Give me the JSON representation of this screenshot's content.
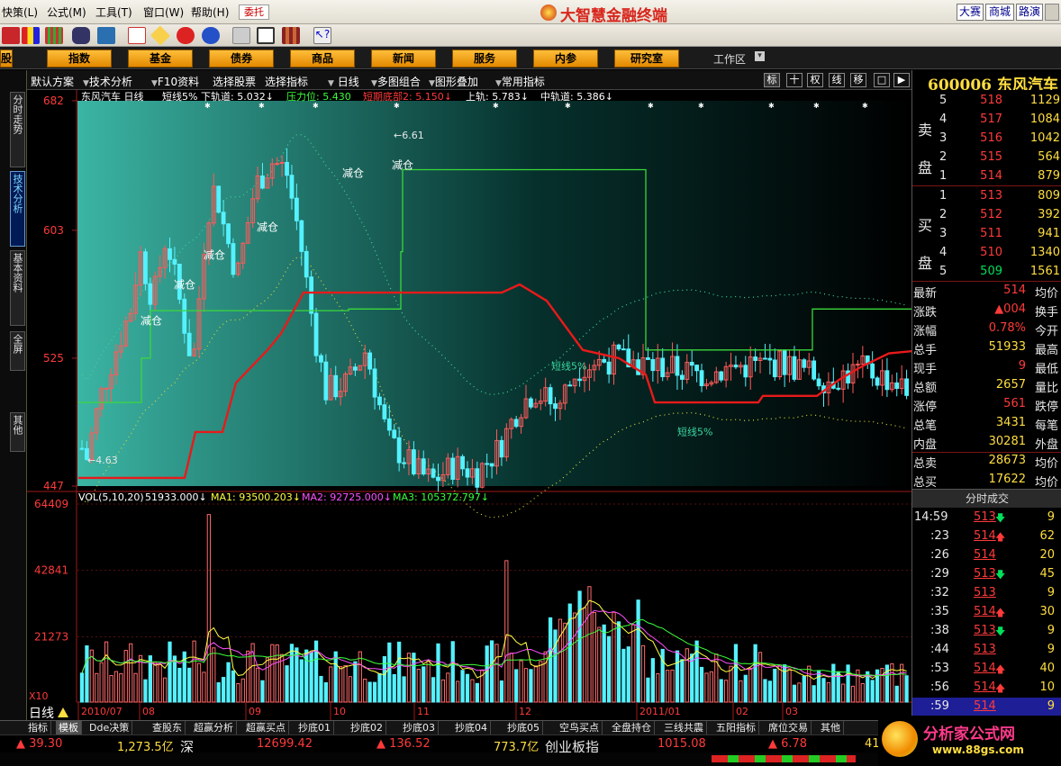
{
  "menu": {
    "items": [
      "快策(L)",
      "公式(M)",
      "工具(T)",
      "窗口(W)",
      "帮助(H)"
    ],
    "entrust": "委托",
    "logo": "大智慧金融终端",
    "right": [
      "大赛",
      "商城",
      "路演"
    ]
  },
  "nav": {
    "items": [
      "股",
      "指数",
      "基金",
      "债券",
      "商品",
      "新闻",
      "服务",
      "内参",
      "研究室"
    ],
    "workarea": "工作区"
  },
  "sidebar": {
    "tabs": [
      "分时走势",
      "技术分析",
      "基本资料",
      "全屏",
      "其他"
    ]
  },
  "toolbar2": {
    "items": [
      "默认方案",
      "技术分析",
      "F10资料",
      "选择股票",
      "选择指标",
      "日线",
      "多图组合",
      "图形叠加",
      "常用指标"
    ],
    "icons": [
      "标",
      "十",
      "权",
      "线",
      "移",
      "□",
      "▶"
    ]
  },
  "stock": {
    "code": "600006",
    "name": "东风汽车"
  },
  "chart_data": [
    {
      "type": "candlestick",
      "title": "东风汽车 日线",
      "indicator_header": {
        "name": "短线5%",
        "lower": "下轨道: 5.032↓",
        "pressure": "压力位: 5.430",
        "bottom": "短期底部2: 5.150↓",
        "upper": "上轨: 5.783↓",
        "mid": "中轨道: 5.386↓"
      },
      "ylim": [
        447,
        682
      ],
      "yticks": [
        "682",
        "603",
        "525",
        "447"
      ],
      "annotations": [
        "减仓",
        "减仓",
        "减仓",
        "减仓",
        "减仓",
        "减仓",
        "6.61",
        "4.63",
        "短线5%",
        "短线5%"
      ],
      "max_label": "6.61",
      "min_label": "4.63",
      "xticks": [
        "2010/07",
        "08",
        "09",
        "10",
        "11",
        "12",
        "2011/01",
        "02",
        "03"
      ],
      "period_label": "日线"
    },
    {
      "type": "bar",
      "title": "VOL(5,10,20)",
      "header": {
        "vol": "51933.000↓",
        "ma1": "MA1: 93500.203↓",
        "ma2": "MA2: 92725.000↓",
        "ma3": "MA3: 105372.797↓"
      },
      "ylim": [
        0,
        64409
      ],
      "yticks": [
        "64409",
        "42841",
        "21273"
      ],
      "unit": "X10"
    }
  ],
  "quote": {
    "sell": [
      {
        "lvl": "5",
        "price": "518",
        "vol": "1129"
      },
      {
        "lvl": "4",
        "price": "517",
        "vol": "1084"
      },
      {
        "lvl": "3",
        "price": "516",
        "vol": "1042"
      },
      {
        "lvl": "2",
        "price": "515",
        "vol": "564"
      },
      {
        "lvl": "1",
        "price": "514",
        "vol": "879"
      }
    ],
    "buy": [
      {
        "lvl": "1",
        "price": "513",
        "vol": "809"
      },
      {
        "lvl": "2",
        "price": "512",
        "vol": "392"
      },
      {
        "lvl": "3",
        "price": "511",
        "vol": "941"
      },
      {
        "lvl": "4",
        "price": "510",
        "vol": "1340"
      },
      {
        "lvl": "5",
        "price": "509",
        "vol": "1561"
      }
    ],
    "sell_label": [
      "卖",
      "盘"
    ],
    "buy_label": [
      "买",
      "盘"
    ],
    "stats": [
      {
        "k": "最新",
        "v": "514",
        "k2": "均价",
        "c": "red"
      },
      {
        "k": "涨跌",
        "v": "▲004",
        "k2": "换手",
        "c": "red"
      },
      {
        "k": "涨幅",
        "v": "0.78%",
        "k2": "今开",
        "c": "red"
      },
      {
        "k": "总手",
        "v": "51933",
        "k2": "最高",
        "c": "yel"
      },
      {
        "k": "现手",
        "v": "9",
        "k2": "最低",
        "c": "red"
      },
      {
        "k": "总额",
        "v": "2657",
        "k2": "量比",
        "c": "yel"
      },
      {
        "k": "涨停",
        "v": "561",
        "k2": "跌停",
        "c": "red"
      },
      {
        "k": "总笔",
        "v": "3431",
        "k2": "每笔",
        "c": "yel"
      },
      {
        "k": "内盘",
        "v": "30281",
        "k2": "外盘",
        "c": "yel"
      },
      {
        "k": "总卖",
        "v": "28673",
        "k2": "均价",
        "c": "yel"
      },
      {
        "k": "总买",
        "v": "17622",
        "k2": "均价",
        "c": "yel"
      }
    ],
    "ticks_header": "分时成交",
    "ticks": [
      {
        "t": "14:59",
        "p": "513",
        "d": "down",
        "v": "9"
      },
      {
        "t": ":23",
        "p": "514",
        "d": "up",
        "v": "62"
      },
      {
        "t": ":26",
        "p": "514",
        "d": "",
        "v": "20"
      },
      {
        "t": ":29",
        "p": "513",
        "d": "down",
        "v": "45"
      },
      {
        "t": ":32",
        "p": "513",
        "d": "",
        "v": "9"
      },
      {
        "t": ":35",
        "p": "514",
        "d": "up",
        "v": "30"
      },
      {
        "t": ":38",
        "p": "513",
        "d": "down",
        "v": "9"
      },
      {
        "t": ":44",
        "p": "513",
        "d": "",
        "v": "9"
      },
      {
        "t": ":53",
        "p": "514",
        "d": "up",
        "v": "40"
      },
      {
        "t": ":56",
        "p": "514",
        "d": "up",
        "v": "10"
      },
      {
        "t": ":59",
        "p": "514",
        "d": "",
        "v": "9"
      }
    ]
  },
  "bottom_tabs": [
    "指标",
    "模板",
    "Dde决策",
    "查股东",
    "超赢分析",
    "超赢买点",
    "抄底01",
    "抄底02",
    "抄底03",
    "抄底04",
    "抄底05",
    "空鸟买点",
    "全盘持仓",
    "三线共震",
    "五阳指标",
    "席位交易",
    "其他"
  ],
  "status": {
    "v1": "▲ 39.30",
    "v2": "1,273.5亿",
    "v3": "深",
    "v4": "12699.42",
    "v5": "▲ 136.52",
    "v6": "773.7亿",
    "v7": "创业板指",
    "v8": "1015.08",
    "v9": "▲ 6.78",
    "v10": "41"
  },
  "brand": {
    "name": "分析家公式网",
    "url": "www.88gs.com"
  }
}
